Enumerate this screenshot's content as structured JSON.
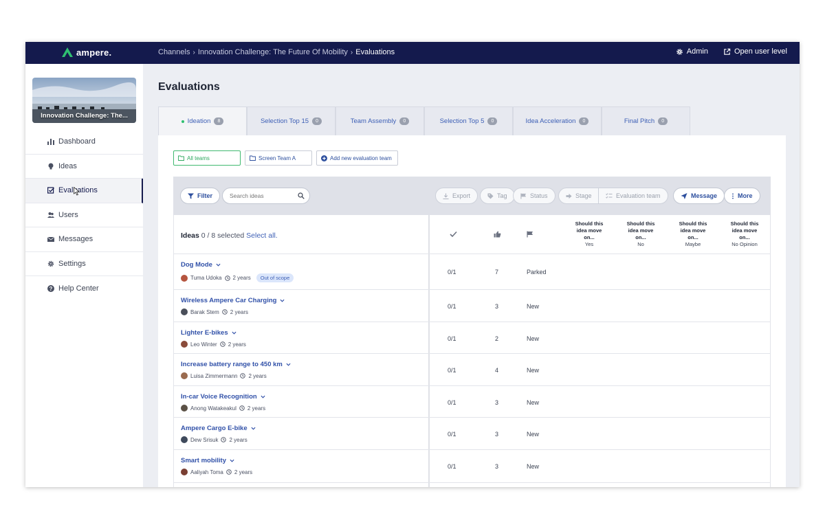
{
  "brand": {
    "name": "ampere.",
    "accent": "#2fbf71",
    "nav_bg": "#141a4d"
  },
  "breadcrumb": [
    "Channels",
    "Innovation Challenge: The Future Of Mobility",
    "Evaluations"
  ],
  "top_actions": {
    "admin": "Admin",
    "open_user_level": "Open user level"
  },
  "channel_card": {
    "title": "Innovation Challenge: The..."
  },
  "sidebar": {
    "items": [
      {
        "label": "Dashboard",
        "icon": "bar-chart-icon"
      },
      {
        "label": "Ideas",
        "icon": "lightbulb-icon"
      },
      {
        "label": "Evaluations",
        "icon": "checkbox-icon",
        "active": true
      },
      {
        "label": "Users",
        "icon": "users-icon"
      },
      {
        "label": "Messages",
        "icon": "envelope-icon"
      },
      {
        "label": "Settings",
        "icon": "gear-icon"
      },
      {
        "label": "Help Center",
        "icon": "question-icon"
      }
    ]
  },
  "page": {
    "title": "Evaluations"
  },
  "tabs": [
    {
      "label": "Ideation",
      "count": "8",
      "active": true
    },
    {
      "label": "Selection Top 15",
      "count": "0"
    },
    {
      "label": "Team Assembly",
      "count": "0"
    },
    {
      "label": "Selection Top 5",
      "count": "0"
    },
    {
      "label": "Idea Acceleration",
      "count": "0"
    },
    {
      "label": "Final Pitch",
      "count": "0"
    }
  ],
  "teams": {
    "all": "All teams",
    "screen": "Screen Team A",
    "add": "Add new evaluation team"
  },
  "toolbar": {
    "filter": "Filter",
    "search_placeholder": "Search ideas",
    "export": "Export",
    "tag": "Tag",
    "status": "Status",
    "stage": "Stage",
    "evaluation_team": "Evaluation team",
    "message": "Message",
    "more": "More"
  },
  "table": {
    "ideas_label": "Ideas",
    "selected": "0 / 8 selected",
    "select_all": "Select all.",
    "question": [
      "Should this",
      "idea move",
      "on..."
    ],
    "answers": [
      "Yes",
      "No",
      "Maybe",
      "No Opinion"
    ],
    "rows": [
      {
        "title": "Dog Mode",
        "author": "Tuma Udoka",
        "age": "2 years",
        "badge": "Out of scope",
        "score": "0/1",
        "likes": "7",
        "status": "Parked",
        "avatar_color": "#b5553f"
      },
      {
        "title": "Wireless Ampere Car Charging",
        "author": "Barak Stem",
        "age": "2 years",
        "score": "0/1",
        "likes": "3",
        "status": "New",
        "avatar_color": "#4a4f5a"
      },
      {
        "title": "Lighter E-bikes",
        "author": "Leo Winter",
        "age": "2 years",
        "score": "0/1",
        "likes": "2",
        "status": "New",
        "avatar_color": "#8a4b3a"
      },
      {
        "title": "Increase battery range to 450 km",
        "author": "Luisa Zimmermann",
        "age": "2 years",
        "score": "0/1",
        "likes": "4",
        "status": "New",
        "avatar_color": "#9a6b4f"
      },
      {
        "title": "In-car Voice Recognition",
        "author": "Anong Watakeakul",
        "age": "2 years",
        "score": "0/1",
        "likes": "3",
        "status": "New",
        "avatar_color": "#5b5146"
      },
      {
        "title": "Ampere Cargo E-bike",
        "author": "Dew Srisuk",
        "age": "2 years",
        "score": "0/1",
        "likes": "3",
        "status": "New",
        "avatar_color": "#3f4a5c"
      },
      {
        "title": "Smart mobility",
        "author": "Aaliyah Toma",
        "age": "2 years",
        "score": "0/1",
        "likes": "3",
        "status": "New",
        "avatar_color": "#7a3f33"
      }
    ]
  }
}
